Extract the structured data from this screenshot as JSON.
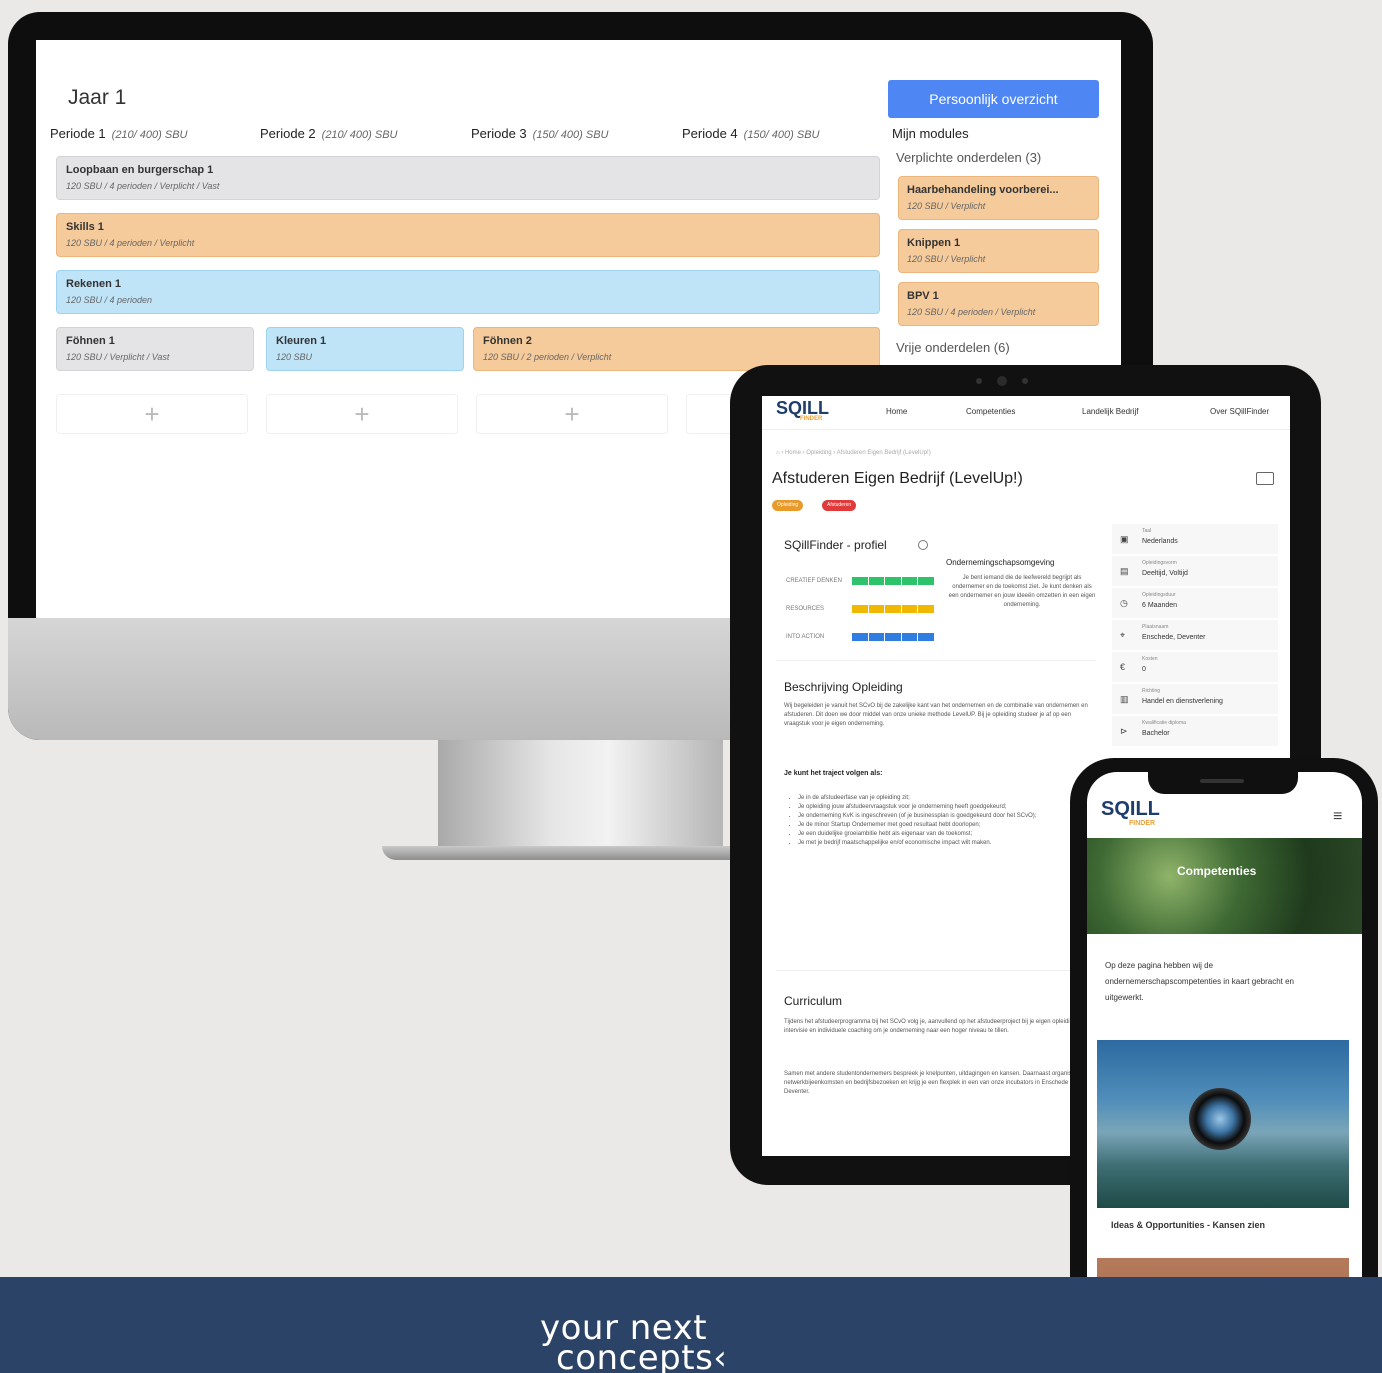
{
  "desktop": {
    "year_title": "Jaar 1",
    "overview_button": "Persoonlijk overzicht",
    "periods": [
      {
        "label": "Periode 1",
        "sbu": "(210/ 400) SBU"
      },
      {
        "label": "Periode 2",
        "sbu": "(210/ 400) SBU"
      },
      {
        "label": "Periode 3",
        "sbu": "(150/ 400) SBU"
      },
      {
        "label": "Periode 4",
        "sbu": "(150/ 400) SBU"
      }
    ],
    "my_modules_label": "Mijn modules",
    "modules": [
      {
        "name": "Loopbaan en burgerschap 1",
        "meta": "120 SBU / 4 perioden / Verplicht / Vast",
        "color": "grey"
      },
      {
        "name": "Skills 1",
        "meta": "120 SBU / 4 perioden / Verplicht",
        "color": "orange"
      },
      {
        "name": "Rekenen 1",
        "meta": "120 SBU / 4 perioden",
        "color": "blue"
      },
      {
        "name": "Föhnen 1",
        "meta": "120 SBU / Verplicht / Vast",
        "color": "grey"
      },
      {
        "name": "Kleuren 1",
        "meta": "120 SBU",
        "color": "blue"
      },
      {
        "name": "Föhnen 2",
        "meta": "120 SBU / 2 perioden / Verplicht",
        "color": "orange"
      }
    ],
    "add_symbol": "+",
    "sidebar": {
      "required_label": "Verplichte onderdelen (3)",
      "required": [
        {
          "name": "Haarbehandeling voorberei...",
          "meta": "120 SBU / Verplicht"
        },
        {
          "name": "Knippen 1",
          "meta": "120 SBU / Verplicht"
        },
        {
          "name": "BPV 1",
          "meta": "120 SBU / 4 perioden / Verplicht"
        }
      ],
      "free_label": "Vrije onderdelen (6)"
    }
  },
  "tablet": {
    "logo": "SQILL",
    "logo_sub": "FINDER",
    "nav": [
      "Home",
      "Competenties",
      "Landelijk Bedrijf",
      "Over SQillFinder"
    ],
    "breadcrumb": "⌂  ›  Home  ›  Opleiding  ›  Afstuderen Eigen Bedrijf (LevelUp!)",
    "title": "Afstuderen Eigen Bedrijf (LevelUp!)",
    "badges": [
      "Opleiding",
      "Afstuderen"
    ],
    "profile_title": "SQillFinder - profiel",
    "profile_rows": [
      "CREATIEF DENKEN",
      "RESOURCES",
      "INTO ACTION"
    ],
    "ondernemings_title": "Ondernemingschapsomgeving",
    "ondernemings_text": "Je bent iemand die de leefwereld begrijpt als ondernemer en de toekomst ziet. Je kunt denken als een ondernemer en jouw ideeën omzetten in een eigen onderneming.",
    "side_info": [
      {
        "icon": "▣",
        "key": "Taal",
        "value": "Nederlands"
      },
      {
        "icon": "▤",
        "key": "Opleidingsvorm",
        "value": "Deeltijd, Voltijd"
      },
      {
        "icon": "◷",
        "key": "Opleidingsduur",
        "value": "6 Maanden"
      },
      {
        "icon": "⌖",
        "key": "Plaatsnaam",
        "value": "Enschede, Deventer"
      },
      {
        "icon": "€",
        "key": "Kosten",
        "value": "0"
      },
      {
        "icon": "▥",
        "key": "Richting",
        "value": "Handel en dienstverlening"
      },
      {
        "icon": "⊳",
        "key": "Kwalificatie diploma",
        "value": "Bachelor"
      }
    ],
    "desc_title": "Beschrijving Opleiding",
    "desc_text": "Wij begeleiden je vanuit het SCvO bij de zakelijke kant van het ondernemen en de combinatie van ondernemen en afstuderen. Dit doen we door middel van onze unieke methode LevelUP. Bij je opleiding studeer je af op een vraagstuk voor je eigen onderneming.",
    "follow_title": "Je kunt het traject volgen als:",
    "follow_items": [
      "Je in de afstudeerfase van je opleiding zit;",
      "Je opleiding jouw afstudeervraagstuk voor je onderneming heeft goedgekeurd;",
      "Je onderneming KvK is ingeschreven (of je businessplan is goedgekeurd door het SCvO);",
      "Je de minor Startup Ondernemer met goed resultaat hebt doorlopen;",
      "Je een duidelijke groeiambitie hebt als eigenaar van de toekomst;",
      "Je met je bedrijf maatschappelijke en/of economische impact wilt maken."
    ],
    "curriculum_title": "Curriculum",
    "curriculum_text": "Tijdens het afstudeerprogramma bij het SCvO volg je, aanvullend op het afstudeerproject bij je eigen opleiding, intervisie en individuele coaching om je onderneming naar een hoger niveau te tillen.",
    "curriculum_text2": "Samen met andere studentondernemers bespreek je knelpunten, uitdagingen en kansen. Daarnaast organiseren we netwerkbijeenkomsten en bedrijfsbezoeken en krijg je een flexplek in een van onze incubators in Enschede of Deventer."
  },
  "phone": {
    "logo": "SQILL",
    "logo_sub": "FINDER",
    "menu_icon": "≡",
    "hero_title": "Competenties",
    "intro": "Op deze pagina hebben wij de ondernemerschapscompetenties in kaart gebracht en uitgewerkt.",
    "card_title": "Ideas & Opportunities - Kansen zien"
  },
  "footer": {
    "line1": "your next",
    "line2": "concepts‹"
  },
  "colors": {
    "accent_blue": "#4e86f4",
    "module_orange": "#f6cb9b",
    "module_blue": "#bfe4f8",
    "module_grey": "#e4e4e6",
    "footer_navy": "#2b4366",
    "bar_green": "#2ec26a",
    "bar_yellow": "#f0b800",
    "bar_blue": "#2f7de1"
  }
}
